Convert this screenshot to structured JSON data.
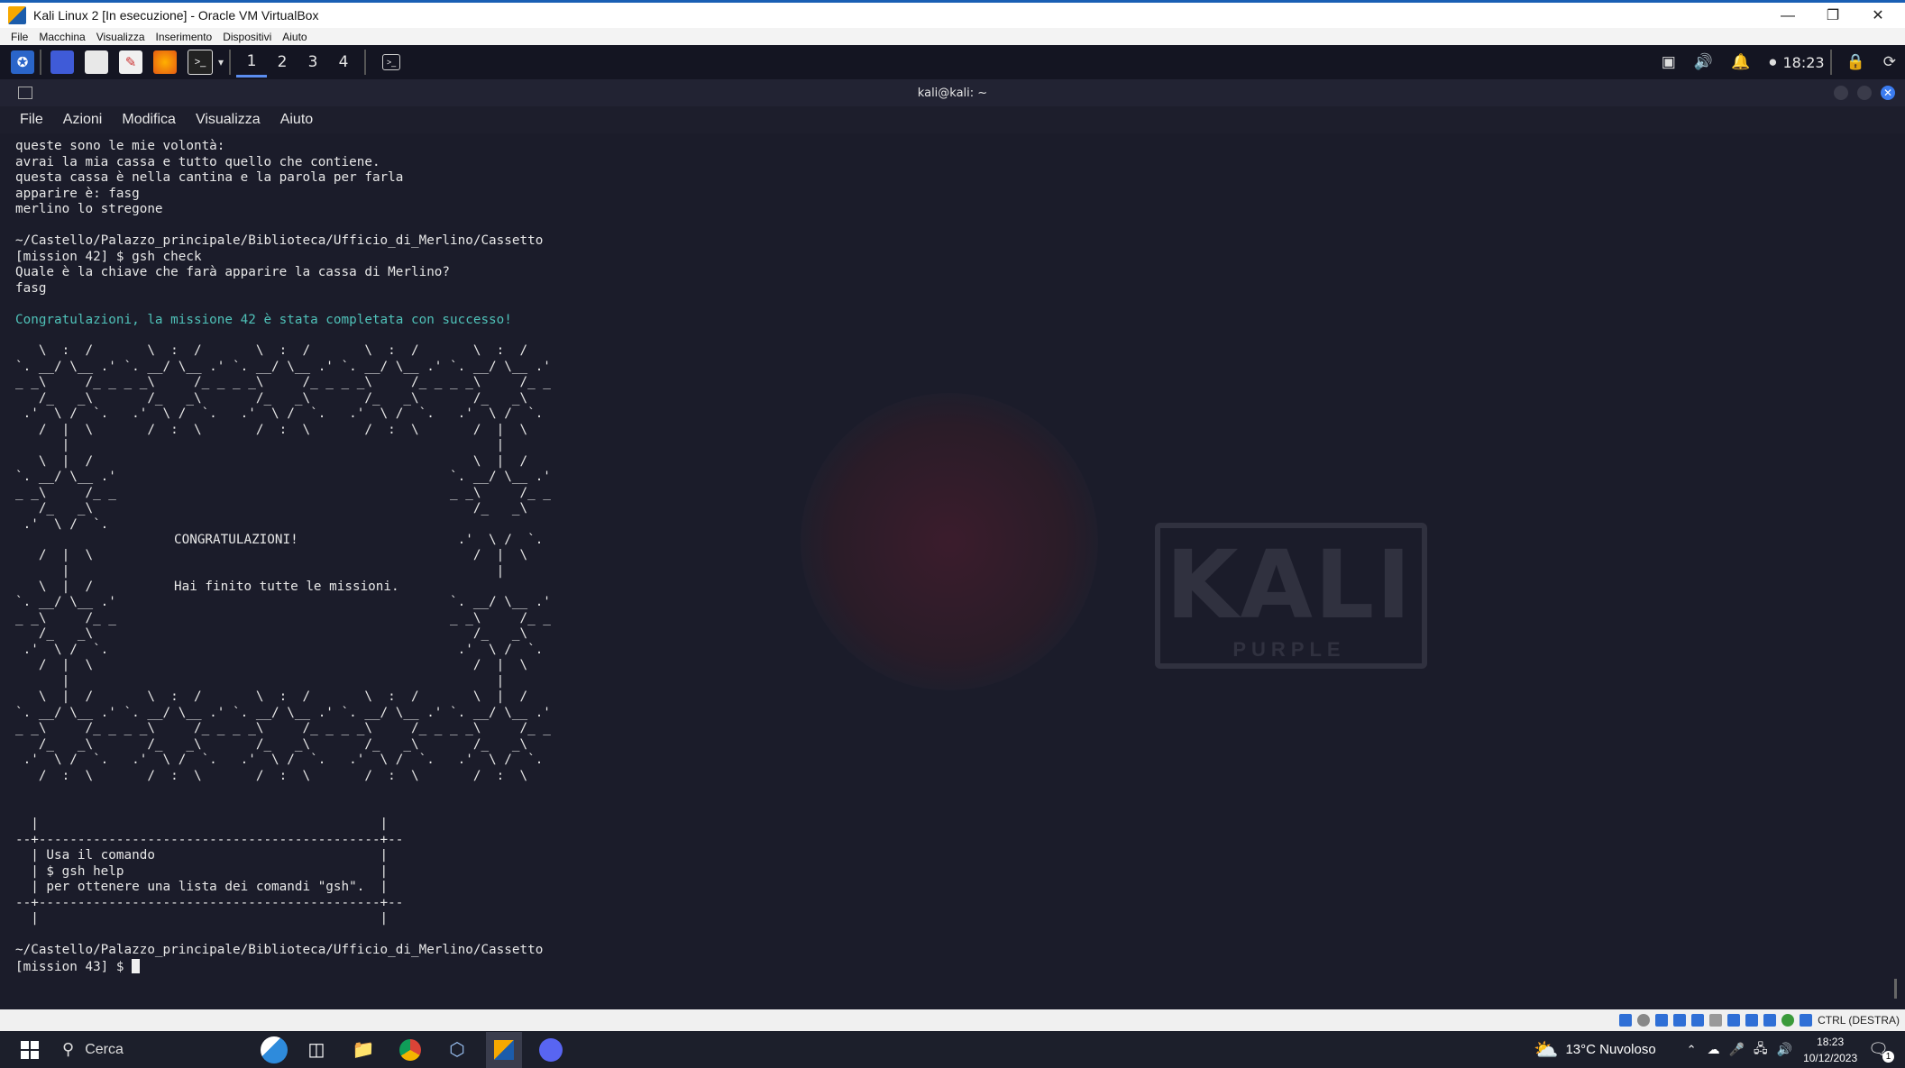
{
  "host_window": {
    "title": "Kali Linux 2 [In esecuzione] - Oracle VM VirtualBox",
    "menu": [
      "File",
      "Macchina",
      "Visualizza",
      "Inserimento",
      "Dispositivi",
      "Aiuto"
    ]
  },
  "kali_panel": {
    "workspaces": [
      "1",
      "2",
      "3",
      "4"
    ],
    "active_workspace": "1",
    "clock": "18:23"
  },
  "terminal": {
    "title": "kali@kali: ~",
    "menu": [
      "File",
      "Azioni",
      "Modifica",
      "Visualizza",
      "Aiuto"
    ],
    "story_lines": [
      "queste sono le mie volontà:",
      "avrai la mia cassa e tutto quello che contiene.",
      "questa cassa è nella cantina e la parola per farla",
      "apparire è: fasg",
      "merlino lo stregone"
    ],
    "path_line_1": "~/Castello/Palazzo_principale/Biblioteca/Ufficio_di_Merlino/Cassetto",
    "prompt_1": "[mission 42] $ gsh check",
    "question": "Quale è la chiave che farà apparire la cassa di Merlino?",
    "answer": "fasg",
    "success_message": "Congratulazioni, la missione 42 è stata completata con successo!",
    "ascii_top": "   \\  :  /       \\  :  /       \\  :  /       \\  :  /       \\  :  /\n`. __/ \\__ .' `. __/ \\__ .' `. __/ \\__ .' `. __/ \\__ .' `. __/ \\__ .'\n_ _\\     /_ _ _ _\\     /_ _ _ _\\     /_ _ _ _\\     /_ _ _ _\\     /_ _\n   /_   _\\       /_   _\\       /_   _\\       /_   _\\       /_   _\\\n .'  \\ /  `.   .'  \\ /  `.   .'  \\ /  `.   .'  \\ /  `.   .'  \\ /  `.\n   /  |  \\       /  :  \\       /  :  \\       /  :  \\       /  |  \\\n      |                                                       |\n   \\  |  /                                                 \\  |  /\n`. __/ \\__ .'                                           `. __/ \\__ .'\n_ _\\     /_ _                                           _ _\\     /_ _\n   /_   _\\                                                 /_   _\\\n .'  \\ /  `.",
    "ascii_bottom_pre": "   /  |  \\                                                 /  |  \\\n      |                                                       |\n   \\  |  /",
    "congrats_title": "CONGRATULAZIONI!",
    "congrats_sub": "Hai finito tutte le missioni.",
    "ascii_mid_right": "                                                         .'  \\ /  `.",
    "ascii_tail": "`. __/ \\__ .'                                           `. __/ \\__ .'\n_ _\\     /_ _                                           _ _\\     /_ _\n   /_   _\\                                                 /_   _\\\n .'  \\ /  `.                                             .'  \\ /  `.\n   /  |  \\                                                 /  |  \\\n      |                                                       |\n   \\  |  /       \\  :  /       \\  :  /       \\  :  /       \\  |  /\n`. __/ \\__ .' `. __/ \\__ .' `. __/ \\__ .' `. __/ \\__ .' `. __/ \\__ .'\n_ _\\     /_ _ _ _\\     /_ _ _ _\\     /_ _ _ _\\     /_ _ _ _\\     /_ _\n   /_   _\\       /_   _\\       /_   _\\       /_   _\\       /_   _\\\n .'  \\ /  `.   .'  \\ /  `.   .'  \\ /  `.   .'  \\ /  `.   .'  \\ /  `.\n   /  :  \\       /  :  \\       /  :  \\       /  :  \\       /  :  \\",
    "box_text": "  |                                            |\n--+--------------------------------------------+--\n  | Usa il comando                             |\n  | $ gsh help                                 |\n  | per ottenere una lista dei comandi \"gsh\".  |\n--+--------------------------------------------+--\n  |                                            |",
    "path_line_2": "~/Castello/Palazzo_principale/Biblioteca/Ufficio_di_Merlino/Cassetto",
    "prompt_2": "[mission 43] $ ",
    "wallpaper_text": "KALI",
    "wallpaper_sub": "PURPLE"
  },
  "vbox_status": {
    "host_key": "CTRL (DESTRA)"
  },
  "taskbar": {
    "search_placeholder": "Cerca",
    "weather": "13°C  Nuvoloso",
    "time": "18:23",
    "date": "10/12/2023",
    "notification_count": "1"
  }
}
